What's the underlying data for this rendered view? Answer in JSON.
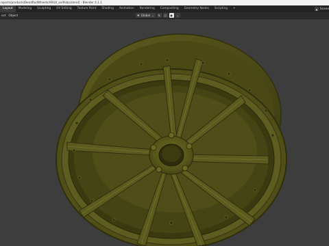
{
  "window": {
    "title": "rojects/products/BendRodWheels/ARUX_xxlRsbo.blend] - Blender 4.1.1"
  },
  "workspaces": {
    "tabs": [
      "Layout",
      "Modeling",
      "Sculpting",
      "UV Editing",
      "Texture Paint",
      "Shading",
      "Animation",
      "Rendering",
      "Compositing",
      "Geometry Nodes",
      "Scripting",
      "+"
    ],
    "active_index": 0
  },
  "scene": {
    "label": "Scene"
  },
  "header": {
    "menu": [
      "ect",
      "Object"
    ],
    "transform_orientation": "Global"
  },
  "icons": {
    "scene": "scene-icon",
    "orientation": "transform-orientation-icon",
    "pivot": "pivot-point-icon",
    "snap": "snap-icon",
    "proportional": "proportional-editing-icon"
  },
  "viewport": {
    "object": "car-wheel-rim",
    "rim_color": "#5b5a1f",
    "background": "#3d3d3d"
  }
}
